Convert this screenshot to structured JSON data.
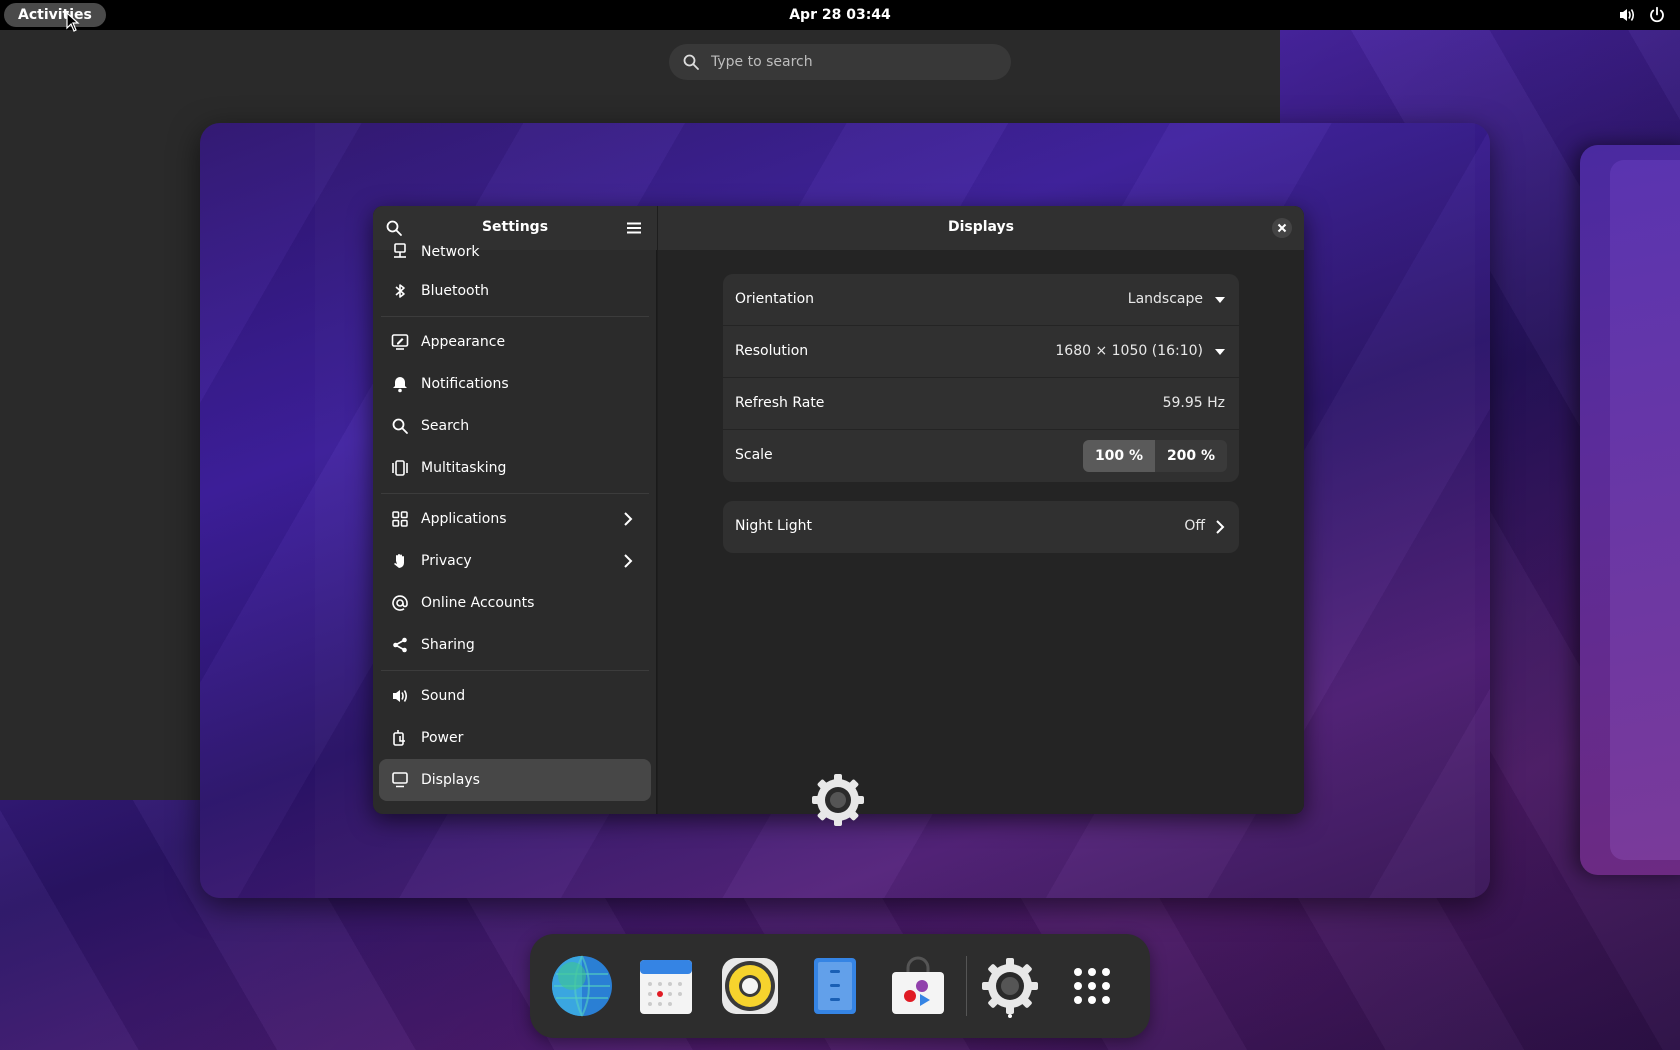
{
  "topbar": {
    "activities_label": "Activities",
    "clock": "Apr 28  03:44",
    "tray_icons": [
      "speaker-icon",
      "power-icon"
    ]
  },
  "search": {
    "placeholder": "Type to search"
  },
  "settings": {
    "sidebar_title": "Settings",
    "content_title": "Displays",
    "sidebar_items": [
      {
        "label": "Network",
        "icon": "network-icon"
      },
      {
        "label": "Bluetooth",
        "icon": "bluetooth-icon"
      },
      {
        "label": "Appearance",
        "icon": "appearance-icon"
      },
      {
        "label": "Notifications",
        "icon": "bell-icon"
      },
      {
        "label": "Search",
        "icon": "search-icon"
      },
      {
        "label": "Multitasking",
        "icon": "multitasking-icon"
      },
      {
        "label": "Applications",
        "icon": "grid-icon"
      },
      {
        "label": "Privacy",
        "icon": "hand-icon"
      },
      {
        "label": "Online Accounts",
        "icon": "at-icon"
      },
      {
        "label": "Sharing",
        "icon": "share-icon"
      },
      {
        "label": "Sound",
        "icon": "speaker-icon"
      },
      {
        "label": "Power",
        "icon": "power-plug-icon"
      },
      {
        "label": "Displays",
        "icon": "display-icon",
        "active": true
      }
    ],
    "display": {
      "orientation_label": "Orientation",
      "orientation_value": "Landscape",
      "resolution_label": "Resolution",
      "resolution_value": "1680 × 1050 (16:10)",
      "refresh_label": "Refresh Rate",
      "refresh_value": "59.95 Hz",
      "scale_label": "Scale",
      "scale_options": [
        "100 %",
        "200 %"
      ],
      "scale_selected": "100 %",
      "night_light_label": "Night Light",
      "night_light_value": "Off"
    }
  },
  "dock": {
    "apps": [
      "web-browser-icon",
      "calendar-icon",
      "rhythmbox-icon",
      "files-icon",
      "software-icon",
      "settings-icon",
      "app-grid-icon"
    ]
  },
  "colors": {
    "topbar": "#000000",
    "sidebar": "#2b2b2b",
    "content": "#242424",
    "active_item": "#474747"
  }
}
